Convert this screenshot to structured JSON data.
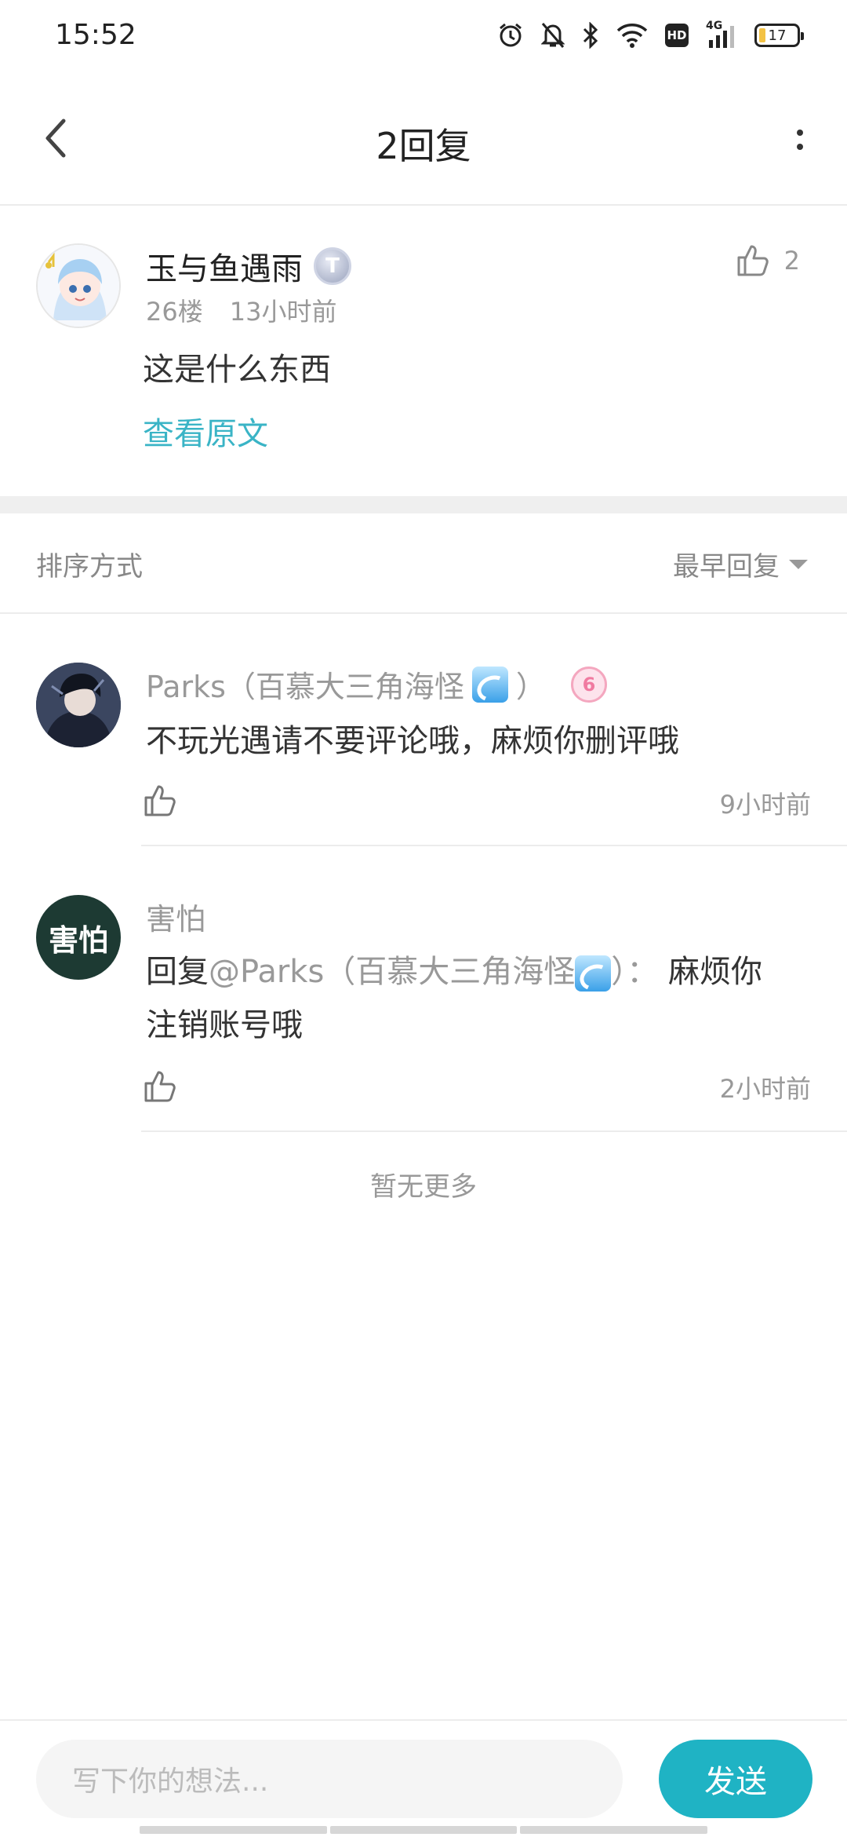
{
  "status_bar": {
    "time": "15:52",
    "battery": "17",
    "network": "4G",
    "hd": "HD"
  },
  "header": {
    "title": "2回复"
  },
  "original_comment": {
    "username": "玉与鱼遇雨",
    "level_badge": "T",
    "floor": "26楼",
    "time": "13小时前",
    "content": "这是什么东西",
    "view_original": "查看原文",
    "likes": "2"
  },
  "sort": {
    "label": "排序方式",
    "selected": "最早回复"
  },
  "replies": [
    {
      "username": "Parks（百慕大三角海怪",
      "username_suffix": "）",
      "level_badge": "6",
      "content": "不玩光遇请不要评论哦，麻烦你删评哦",
      "time": "9小时前"
    },
    {
      "username": "害怕",
      "avatar_text": "害怕",
      "reply_prefix": "回复",
      "mention": "@Parks（百慕大三角海怪",
      "mention_suffix": "）：",
      "content_line1": "麻烦你",
      "content_line2": "注销账号哦",
      "time": "2小时前"
    }
  ],
  "footer_text": "暂无更多",
  "input": {
    "placeholder": "写下你的想法...",
    "send_label": "发送"
  }
}
